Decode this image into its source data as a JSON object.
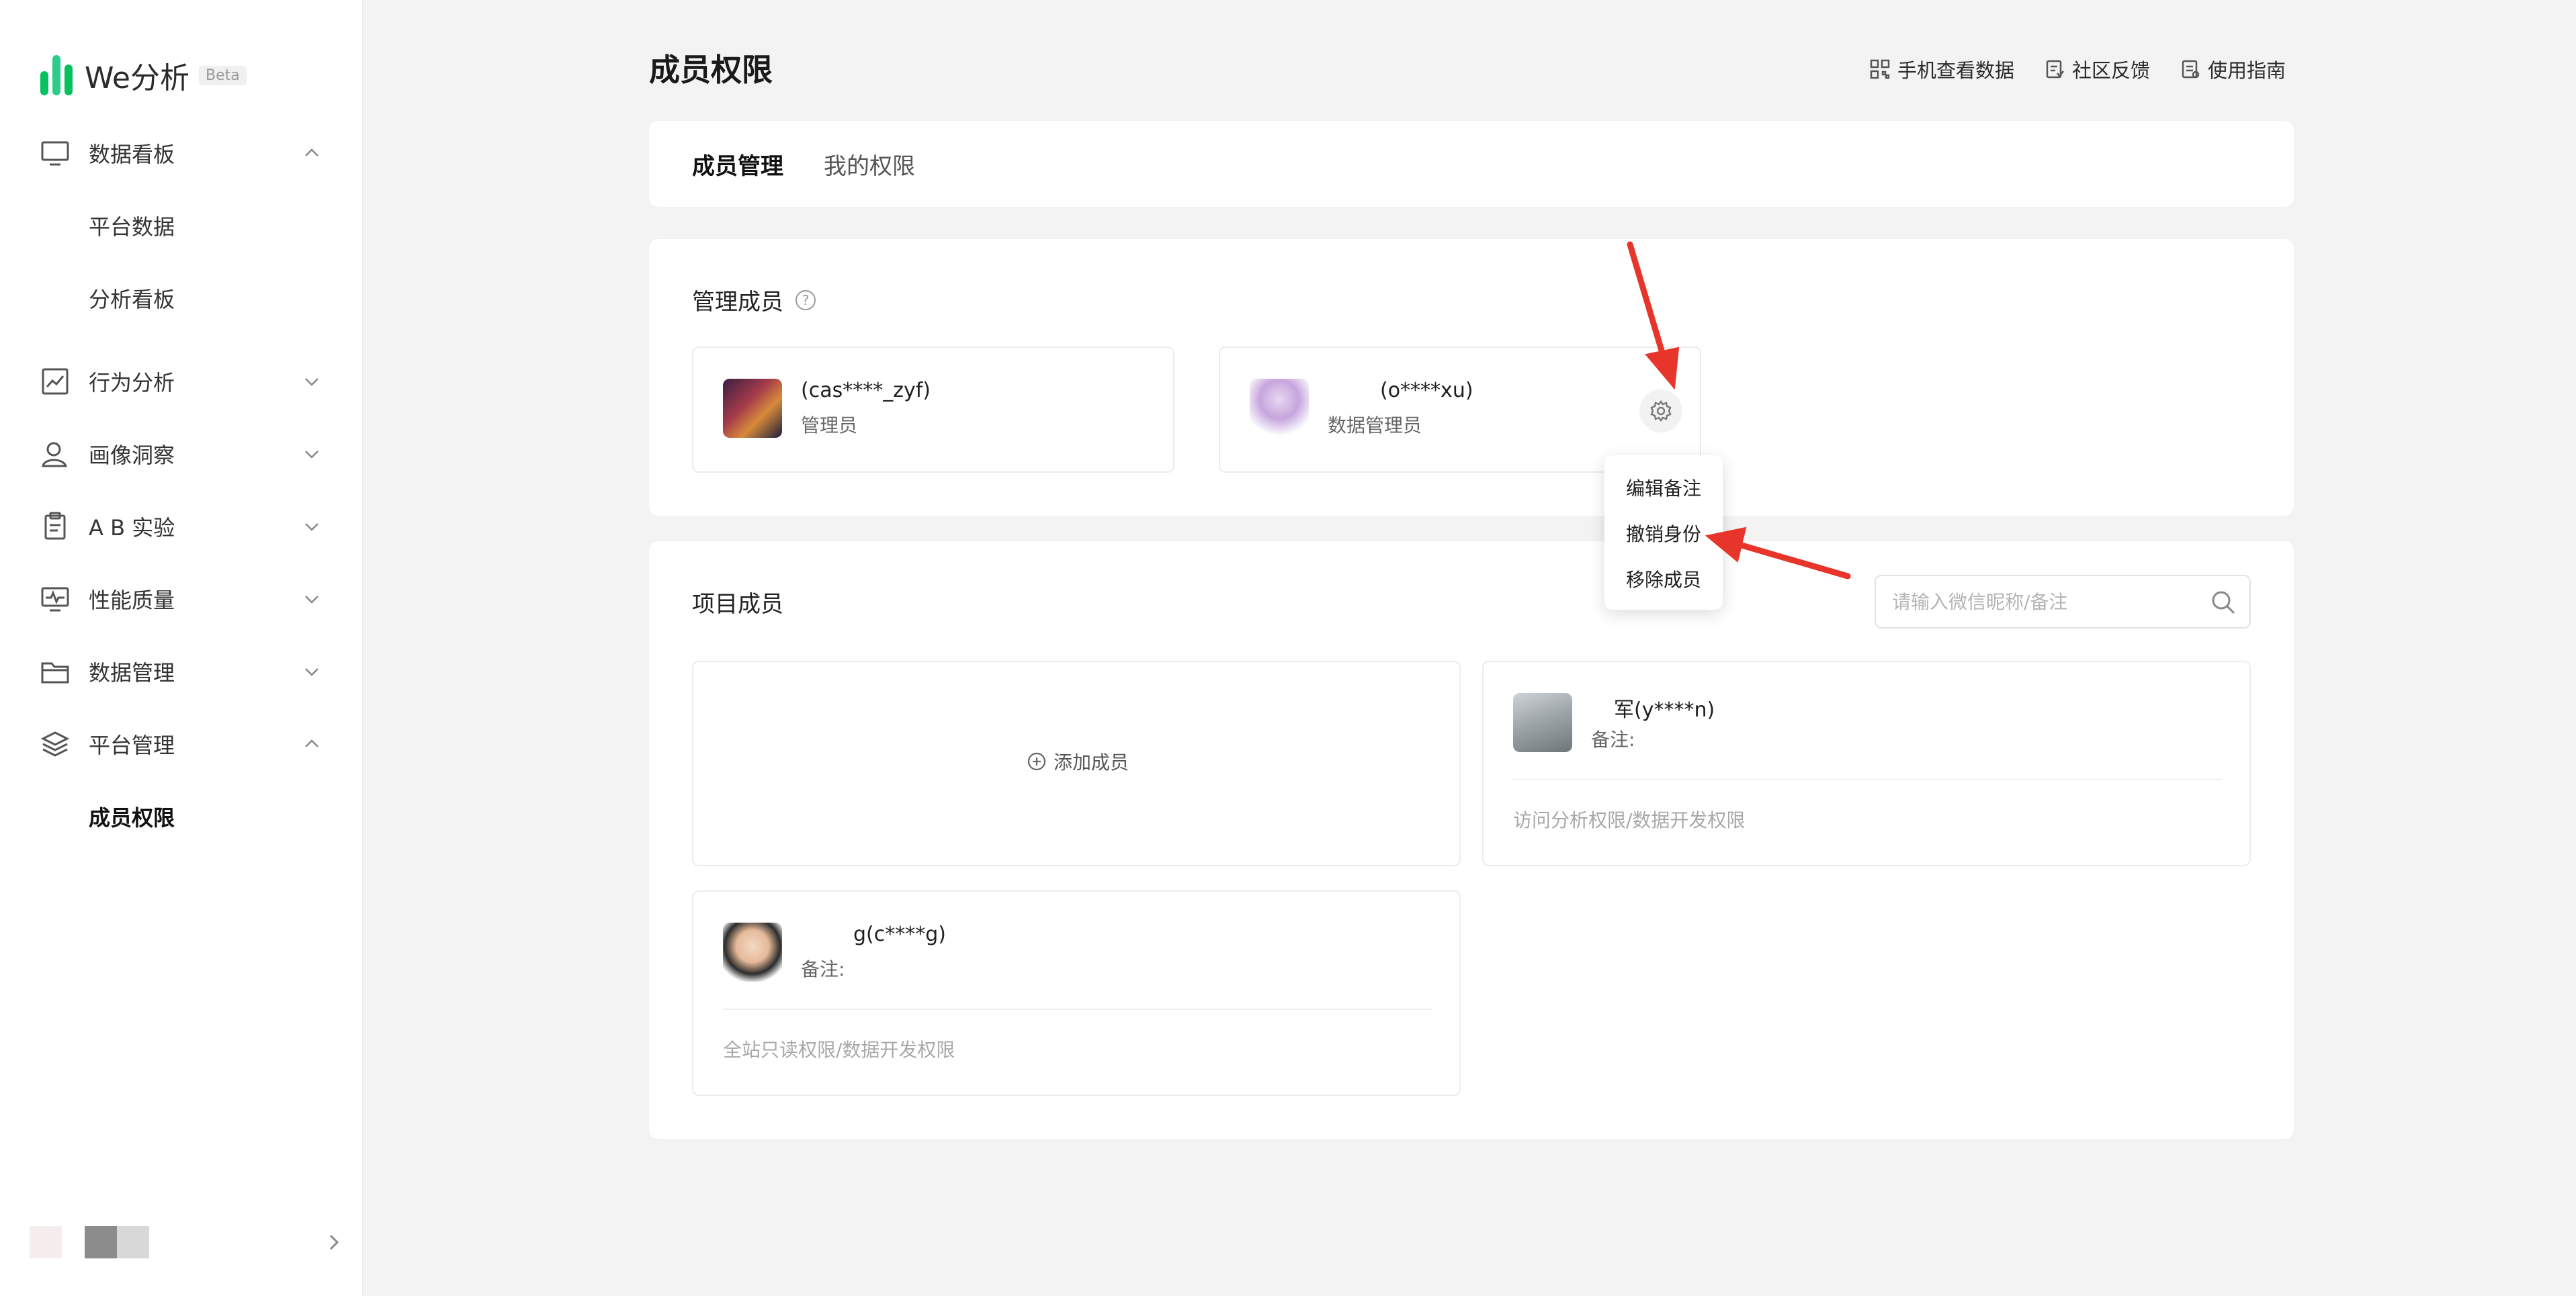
{
  "app": {
    "name": "We分析",
    "badge": "Beta"
  },
  "sidebar": {
    "sections": [
      {
        "label": "数据看板",
        "icon": "monitor-icon",
        "expanded": true
      },
      {
        "label": "行为分析",
        "icon": "line-chart-icon",
        "expanded": false
      },
      {
        "label": "画像洞察",
        "icon": "user-icon",
        "expanded": false
      },
      {
        "label": "A B 实验",
        "icon": "clipboard-icon",
        "expanded": false
      },
      {
        "label": "性能质量",
        "icon": "pulse-monitor-icon",
        "expanded": false
      },
      {
        "label": "数据管理",
        "icon": "folder-icon",
        "expanded": false
      },
      {
        "label": "平台管理",
        "icon": "layers-icon",
        "expanded": true
      }
    ],
    "sub_items": {
      "dashboard_0": "平台数据",
      "dashboard_1": "分析看板",
      "platform_0": "成员权限"
    },
    "active_item": "成员权限"
  },
  "page": {
    "title": "成员权限"
  },
  "top_links": [
    {
      "label": "手机查看数据",
      "icon": "qrcode-icon"
    },
    {
      "label": "社区反馈",
      "icon": "feedback-icon"
    },
    {
      "label": "使用指南",
      "icon": "guide-icon"
    }
  ],
  "tabs": [
    {
      "label": "成员管理",
      "active": true
    },
    {
      "label": "我的权限",
      "active": false
    }
  ],
  "admins": {
    "title": "管理成员",
    "members": [
      {
        "name": "(cas****_zyf)",
        "role": "管理员"
      },
      {
        "name": "(o****xu)",
        "role": "数据管理员"
      }
    ]
  },
  "admin_menu": {
    "items": [
      "编辑备注",
      "撤销身份",
      "移除成员"
    ]
  },
  "project": {
    "title": "项目成员",
    "search_placeholder": "请输入微信昵称/备注",
    "add_label": "添加成员",
    "members": [
      {
        "name": "军(y****n)",
        "note": "备注:",
        "permissions": "访问分析权限/数据开发权限"
      },
      {
        "name": "g(c****g)",
        "note": "备注:",
        "permissions": "全站只读权限/数据开发权限"
      }
    ]
  },
  "colors": {
    "brand": "#07c160",
    "annotation_arrow": "#e8352b",
    "background": "#f3f3f4"
  }
}
